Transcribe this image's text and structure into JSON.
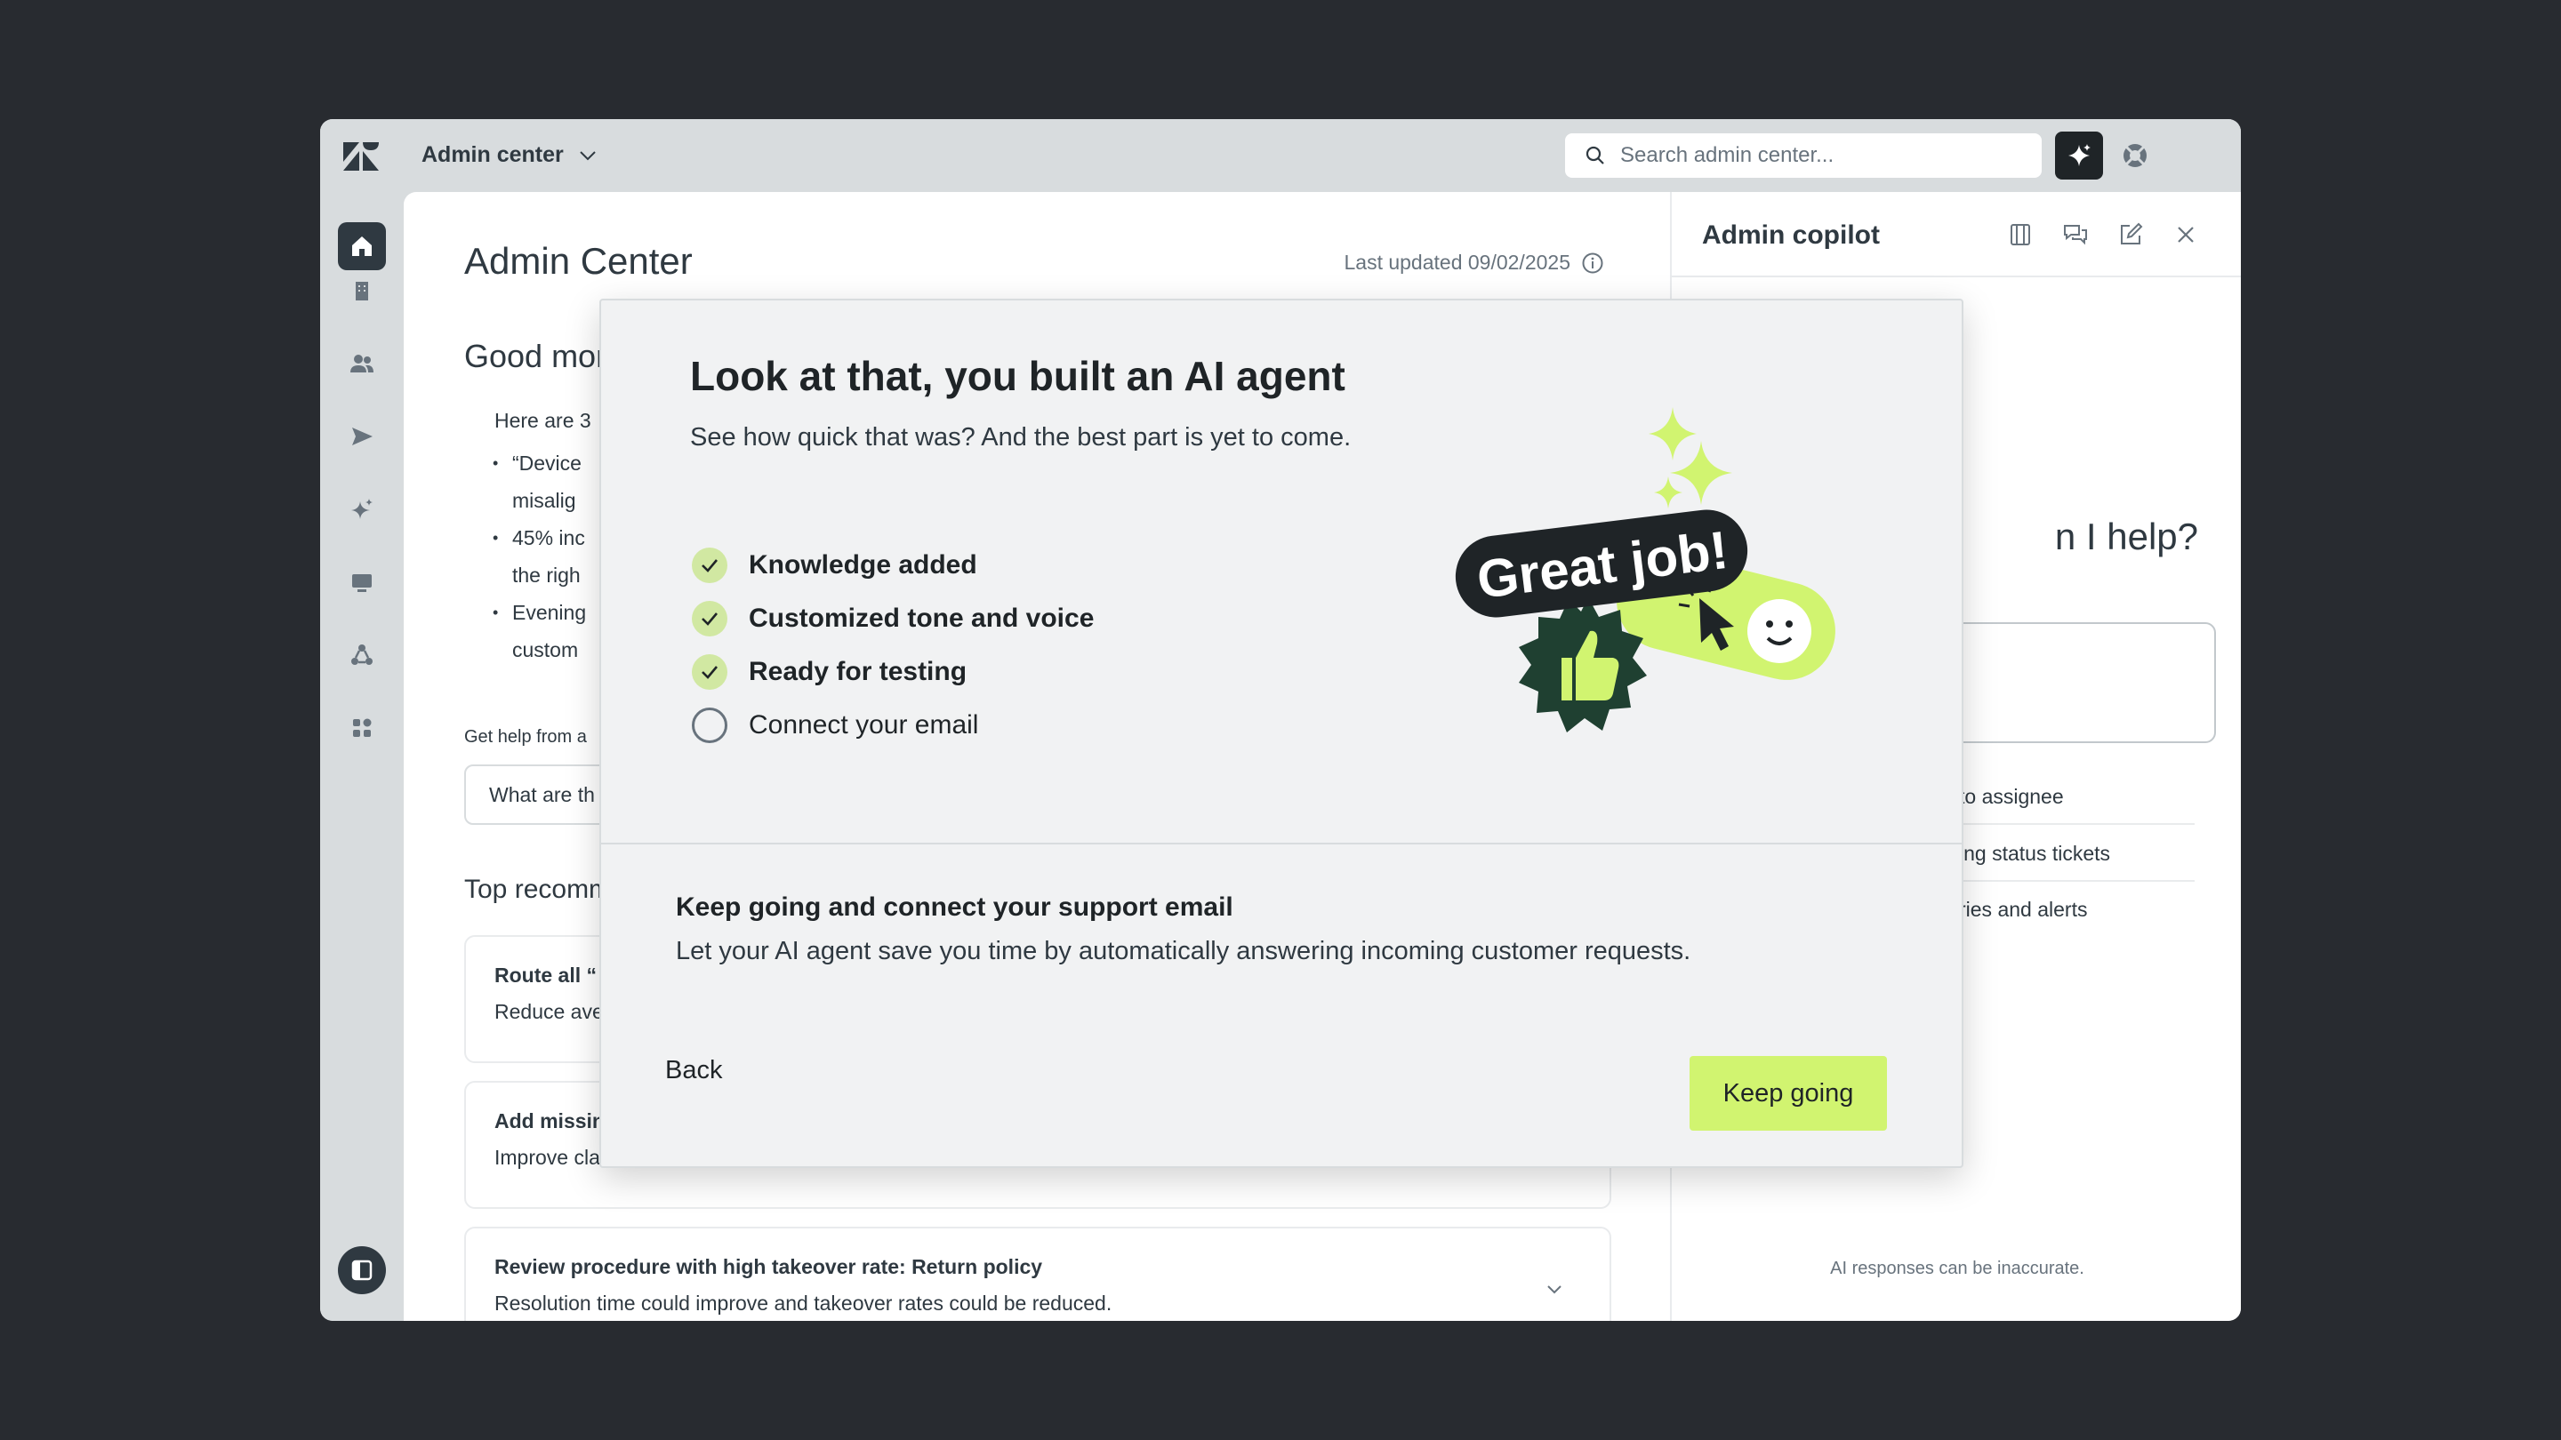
{
  "topbar": {
    "product_label": "Admin center",
    "search_placeholder": "Search admin center..."
  },
  "main": {
    "title": "Admin Center",
    "last_updated": "Last updated 09/02/2025",
    "greeting": "Good mor",
    "intro": "Here are 3",
    "bullets": [
      "“Device",
      "misalig",
      "45% inc",
      "the righ",
      "Evening",
      "custom"
    ],
    "get_help": "Get help from a",
    "ask_placeholder": "What are th",
    "top_recommendations": "Top recomm",
    "cards": [
      {
        "title": "Route all “",
        "desc": "Reduce ave"
      },
      {
        "title": "Add missin",
        "desc": "Improve cla"
      },
      {
        "title": "Review procedure with high takeover rate: Return policy",
        "desc": "Resolution time could improve and takeover rates could be reduced."
      }
    ]
  },
  "copilot": {
    "title": "Admin copilot",
    "help_question": "n I help?",
    "suggestions": [
      "to assignee",
      "ing status tickets",
      "ries and alerts"
    ],
    "disclaimer": "AI responses can be inaccurate."
  },
  "modal": {
    "title": "Look at that, you built an AI agent",
    "subtitle": "See how quick that was? And the best part is yet to come.",
    "steps": [
      {
        "label": "Knowledge added",
        "done": true
      },
      {
        "label": "Customized tone and voice",
        "done": true
      },
      {
        "label": "Ready for testing",
        "done": true
      },
      {
        "label": "Connect your email",
        "done": false
      }
    ],
    "badge_text": "Great job!",
    "next_heading": "Keep going and connect your support email",
    "next_text": "Let your AI agent save you time by automatically answering incoming customer requests.",
    "back_label": "Back",
    "primary_label": "Keep going"
  },
  "colors": {
    "accent": "#d1f470",
    "check_bg": "#d1e8a2",
    "dark": "#2f3941",
    "badge_green": "#1f4031"
  }
}
